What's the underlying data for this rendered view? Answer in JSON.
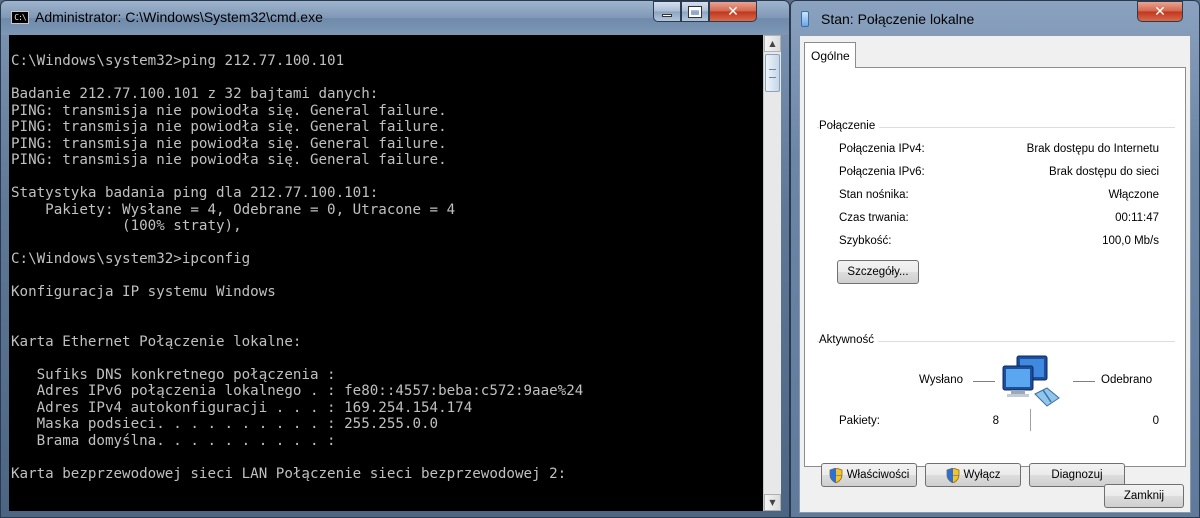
{
  "cmd": {
    "title": "Administrator: C:\\Windows\\System32\\cmd.exe",
    "icon_label": "C:\\",
    "lines": [
      "C:\\Windows\\system32>ping 212.77.100.101",
      "",
      "Badanie 212.77.100.101 z 32 bajtami danych:",
      "PING: transmisja nie powiodła się. General failure.",
      "PING: transmisja nie powiodła się. General failure.",
      "PING: transmisja nie powiodła się. General failure.",
      "PING: transmisja nie powiodła się. General failure.",
      "",
      "Statystyka badania ping dla 212.77.100.101:",
      "    Pakiety: Wysłane = 4, Odebrane = 0, Utracone = 4",
      "             (100% straty),",
      "",
      "C:\\Windows\\system32>ipconfig",
      "",
      "Konfiguracja IP systemu Windows",
      "",
      "",
      "Karta Ethernet Połączenie lokalne:",
      "",
      "   Sufiks DNS konkretnego połączenia :",
      "   Adres IPv6 połączenia lokalnego . : fe80::4557:beba:c572:9aae%24",
      "   Adres IPv4 autokonfiguracji . . . : 169.254.154.174",
      "   Maska podsieci. . . . . . . . . . : 255.255.0.0",
      "   Brama domyślna. . . . . . . . . . :",
      "",
      "Karta bezprzewodowej sieci LAN Połączenie sieci bezprzewodowej 2:"
    ]
  },
  "dialog": {
    "title": "Stan: Połączenie lokalne",
    "tab": "Ogólne",
    "connection_group": "Połączenie",
    "rows": [
      {
        "label": "Połączenia IPv4:",
        "value": "Brak dostępu do Internetu"
      },
      {
        "label": "Połączenia IPv6:",
        "value": "Brak dostępu do sieci"
      },
      {
        "label": "Stan nośnika:",
        "value": "Włączone"
      },
      {
        "label": "Czas trwania:",
        "value": "00:11:47"
      },
      {
        "label": "Szybkość:",
        "value": "100,0 Mb/s"
      }
    ],
    "details_button": "Szczegóły...",
    "activity_group": "Aktywność",
    "sent_label": "Wysłano",
    "received_label": "Odebrano",
    "packets_label": "Pakiety:",
    "packets_sent": "8",
    "packets_received": "0",
    "properties_button": "Właściwości",
    "disable_button": "Wyłącz",
    "diagnose_button": "Diagnozuj",
    "close_button": "Zamknij"
  }
}
